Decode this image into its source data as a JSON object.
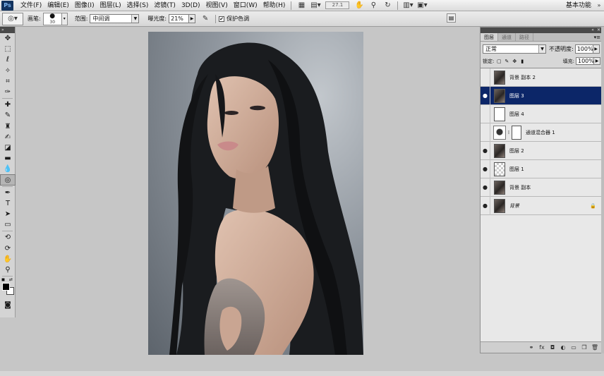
{
  "app": {
    "logo": "Ps"
  },
  "menu": {
    "items": [
      "文件(F)",
      "编辑(E)",
      "图像(I)",
      "图层(L)",
      "选择(S)",
      "滤镜(T)",
      "3D(D)",
      "视图(V)",
      "窗口(W)",
      "帮助(H)"
    ],
    "zoom": "27.1",
    "workspace": "基本功能"
  },
  "options": {
    "brush_label": "画笔:",
    "brush_size": "30",
    "range_label": "范围:",
    "range_value": "中间调",
    "exposure_label": "曝光度:",
    "exposure_value": "21%",
    "protect_label": "保护色调",
    "protect_checked": "✔"
  },
  "toolbox": {
    "tools": [
      "move-icon",
      "marquee-icon",
      "lasso-icon",
      "magic-wand-icon",
      "crop-icon",
      "eyedropper-icon",
      "healing-icon",
      "brush-icon",
      "stamp-icon",
      "history-brush-icon",
      "eraser-icon",
      "gradient-icon",
      "blur-icon",
      "dodge-icon",
      "pen-icon",
      "type-icon",
      "path-select-icon",
      "shape-icon",
      "3d-rotate-icon",
      "3d-orbit-icon",
      "hand-icon",
      "zoom-icon"
    ],
    "fg_color": "#000000",
    "bg_color": "#ffffff"
  },
  "layers_panel": {
    "tabs": [
      "图层",
      "通道",
      "路径"
    ],
    "blend_mode": "正常",
    "opacity_label": "不透明度:",
    "opacity_value": "100%",
    "lock_label": "锁定:",
    "fill_label": "填充:",
    "fill_value": "100%",
    "layers": [
      {
        "name": "背景 副本 2",
        "visible": false,
        "thumb": "photo"
      },
      {
        "name": "图层 3",
        "visible": true,
        "thumb": "photo",
        "selected": true
      },
      {
        "name": "图层 4",
        "visible": false,
        "thumb": "white"
      },
      {
        "name": "通道混合器 1",
        "visible": false,
        "thumb": "adjustment"
      },
      {
        "name": "图层 2",
        "visible": true,
        "thumb": "photo"
      },
      {
        "name": "图层 1",
        "visible": true,
        "thumb": "checker"
      },
      {
        "name": "背景 副本",
        "visible": true,
        "thumb": "photo"
      },
      {
        "name": "背景",
        "visible": true,
        "thumb": "photo",
        "locked": true
      }
    ]
  },
  "canvas": {
    "subject": "portrait-photo",
    "bg_color": "#8f969e"
  }
}
